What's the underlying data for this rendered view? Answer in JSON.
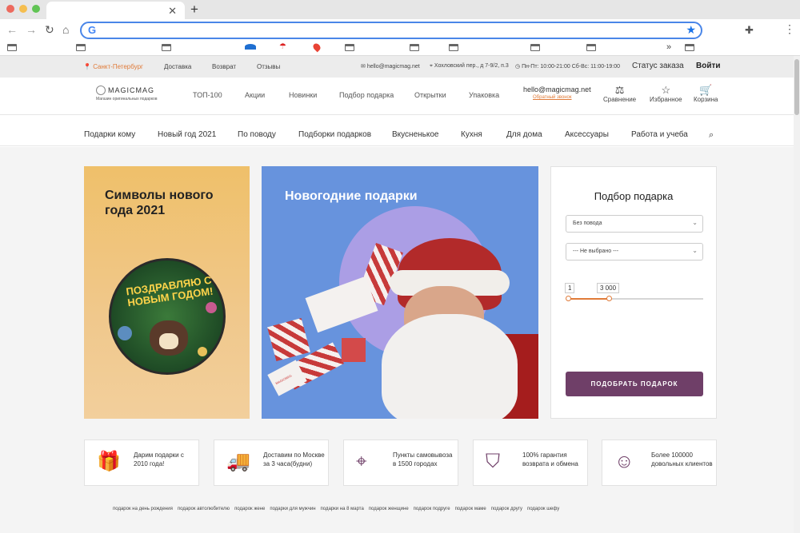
{
  "browser": {
    "url": "",
    "colors": {
      "close": "#ed6a5e",
      "minimize": "#f5be4f",
      "maximize": "#61c454",
      "accent": "#4a86e8"
    }
  },
  "topbar": {
    "city": "Санкт-Петербург",
    "links": [
      "Доставка",
      "Возврат",
      "Отзывы"
    ],
    "email": "hello@magicmag.net",
    "address": "Хохловский пер., д 7-9/2, п.3",
    "hours": "Пн-Пт: 10:00-21:00 Сб-Вс: 11:00-19:00",
    "order_status": "Статус заказа",
    "login": "Войти"
  },
  "header": {
    "logo_name": "MAGICMAG",
    "logo_tagline": "Магазин оригинальных подарков",
    "nav": [
      "ТОП-100",
      "Акции",
      "Новинки",
      "Подбор подарка",
      "Открытки",
      "Упаковка"
    ],
    "email": "hello@magicmag.net",
    "callback": "Обратный звонок",
    "icons": [
      {
        "label": "Сравнение",
        "icon": "compare-icon"
      },
      {
        "label": "Избранное",
        "icon": "star-icon"
      },
      {
        "label": "Корзина",
        "icon": "cart-icon"
      }
    ]
  },
  "categories": [
    "Подарки кому",
    "Новый год 2021",
    "По поводу",
    "Подборки подарков",
    "Вкусненькое",
    "Кухня",
    "Для дома",
    "Аксессуары",
    "Работа и учеба"
  ],
  "banners": {
    "left_title": "Символы нового года 2021",
    "plate_text": "ПОЗДРАВЛЯЮ С НОВЫМ ГОДОМ!",
    "center_title": "Новогодние подарки",
    "gift_brand": "MAGICMAG"
  },
  "gift_finder": {
    "title": "Подбор подарка",
    "occasion_value": "Без повода",
    "recipient_value": "--- Не выбрано ---",
    "price_min": "1",
    "price_max": "3 000",
    "button": "ПОДОБРАТЬ ПОДАРОК",
    "accent": "#6f3f68",
    "slider_fill": 0.3
  },
  "features": [
    {
      "text": "Дарим подарки с 2010 года!",
      "icon": "gift-icon"
    },
    {
      "text": "Доставим по Москве за 3 часа(будни)",
      "icon": "truck-icon"
    },
    {
      "text": "Пункты самовывоза в 1500 городах",
      "icon": "location-icon"
    },
    {
      "text": "100% гарантия возврата и обмена",
      "icon": "shield-icon"
    },
    {
      "text": "Более 100000 довольных клиентов",
      "icon": "smile-icon"
    }
  ],
  "tags": [
    "подарок на день рождения",
    "подарок автолюбителю",
    "подарок жене",
    "подарки для мужчин",
    "подарки на 8 марта",
    "подарок женщине",
    "подарок подруге",
    "подарок маме",
    "подарок другу",
    "подарок шефу"
  ]
}
